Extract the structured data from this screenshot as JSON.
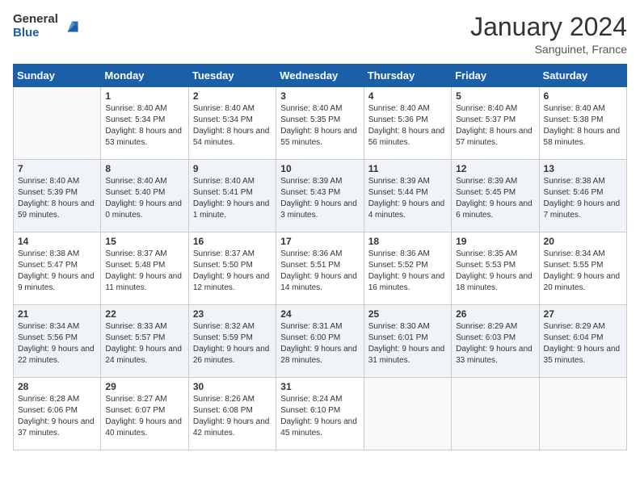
{
  "logo": {
    "general": "General",
    "blue": "Blue"
  },
  "header": {
    "month": "January 2024",
    "location": "Sanguinet, France"
  },
  "weekdays": [
    "Sunday",
    "Monday",
    "Tuesday",
    "Wednesday",
    "Thursday",
    "Friday",
    "Saturday"
  ],
  "weeks": [
    [
      {
        "day": "",
        "sunrise": "",
        "sunset": "",
        "daylight": ""
      },
      {
        "day": "1",
        "sunrise": "Sunrise: 8:40 AM",
        "sunset": "Sunset: 5:34 PM",
        "daylight": "Daylight: 8 hours and 53 minutes."
      },
      {
        "day": "2",
        "sunrise": "Sunrise: 8:40 AM",
        "sunset": "Sunset: 5:34 PM",
        "daylight": "Daylight: 8 hours and 54 minutes."
      },
      {
        "day": "3",
        "sunrise": "Sunrise: 8:40 AM",
        "sunset": "Sunset: 5:35 PM",
        "daylight": "Daylight: 8 hours and 55 minutes."
      },
      {
        "day": "4",
        "sunrise": "Sunrise: 8:40 AM",
        "sunset": "Sunset: 5:36 PM",
        "daylight": "Daylight: 8 hours and 56 minutes."
      },
      {
        "day": "5",
        "sunrise": "Sunrise: 8:40 AM",
        "sunset": "Sunset: 5:37 PM",
        "daylight": "Daylight: 8 hours and 57 minutes."
      },
      {
        "day": "6",
        "sunrise": "Sunrise: 8:40 AM",
        "sunset": "Sunset: 5:38 PM",
        "daylight": "Daylight: 8 hours and 58 minutes."
      }
    ],
    [
      {
        "day": "7",
        "sunrise": "Sunrise: 8:40 AM",
        "sunset": "Sunset: 5:39 PM",
        "daylight": "Daylight: 8 hours and 59 minutes."
      },
      {
        "day": "8",
        "sunrise": "Sunrise: 8:40 AM",
        "sunset": "Sunset: 5:40 PM",
        "daylight": "Daylight: 9 hours and 0 minutes."
      },
      {
        "day": "9",
        "sunrise": "Sunrise: 8:40 AM",
        "sunset": "Sunset: 5:41 PM",
        "daylight": "Daylight: 9 hours and 1 minute."
      },
      {
        "day": "10",
        "sunrise": "Sunrise: 8:39 AM",
        "sunset": "Sunset: 5:43 PM",
        "daylight": "Daylight: 9 hours and 3 minutes."
      },
      {
        "day": "11",
        "sunrise": "Sunrise: 8:39 AM",
        "sunset": "Sunset: 5:44 PM",
        "daylight": "Daylight: 9 hours and 4 minutes."
      },
      {
        "day": "12",
        "sunrise": "Sunrise: 8:39 AM",
        "sunset": "Sunset: 5:45 PM",
        "daylight": "Daylight: 9 hours and 6 minutes."
      },
      {
        "day": "13",
        "sunrise": "Sunrise: 8:38 AM",
        "sunset": "Sunset: 5:46 PM",
        "daylight": "Daylight: 9 hours and 7 minutes."
      }
    ],
    [
      {
        "day": "14",
        "sunrise": "Sunrise: 8:38 AM",
        "sunset": "Sunset: 5:47 PM",
        "daylight": "Daylight: 9 hours and 9 minutes."
      },
      {
        "day": "15",
        "sunrise": "Sunrise: 8:37 AM",
        "sunset": "Sunset: 5:48 PM",
        "daylight": "Daylight: 9 hours and 11 minutes."
      },
      {
        "day": "16",
        "sunrise": "Sunrise: 8:37 AM",
        "sunset": "Sunset: 5:50 PM",
        "daylight": "Daylight: 9 hours and 12 minutes."
      },
      {
        "day": "17",
        "sunrise": "Sunrise: 8:36 AM",
        "sunset": "Sunset: 5:51 PM",
        "daylight": "Daylight: 9 hours and 14 minutes."
      },
      {
        "day": "18",
        "sunrise": "Sunrise: 8:36 AM",
        "sunset": "Sunset: 5:52 PM",
        "daylight": "Daylight: 9 hours and 16 minutes."
      },
      {
        "day": "19",
        "sunrise": "Sunrise: 8:35 AM",
        "sunset": "Sunset: 5:53 PM",
        "daylight": "Daylight: 9 hours and 18 minutes."
      },
      {
        "day": "20",
        "sunrise": "Sunrise: 8:34 AM",
        "sunset": "Sunset: 5:55 PM",
        "daylight": "Daylight: 9 hours and 20 minutes."
      }
    ],
    [
      {
        "day": "21",
        "sunrise": "Sunrise: 8:34 AM",
        "sunset": "Sunset: 5:56 PM",
        "daylight": "Daylight: 9 hours and 22 minutes."
      },
      {
        "day": "22",
        "sunrise": "Sunrise: 8:33 AM",
        "sunset": "Sunset: 5:57 PM",
        "daylight": "Daylight: 9 hours and 24 minutes."
      },
      {
        "day": "23",
        "sunrise": "Sunrise: 8:32 AM",
        "sunset": "Sunset: 5:59 PM",
        "daylight": "Daylight: 9 hours and 26 minutes."
      },
      {
        "day": "24",
        "sunrise": "Sunrise: 8:31 AM",
        "sunset": "Sunset: 6:00 PM",
        "daylight": "Daylight: 9 hours and 28 minutes."
      },
      {
        "day": "25",
        "sunrise": "Sunrise: 8:30 AM",
        "sunset": "Sunset: 6:01 PM",
        "daylight": "Daylight: 9 hours and 31 minutes."
      },
      {
        "day": "26",
        "sunrise": "Sunrise: 8:29 AM",
        "sunset": "Sunset: 6:03 PM",
        "daylight": "Daylight: 9 hours and 33 minutes."
      },
      {
        "day": "27",
        "sunrise": "Sunrise: 8:29 AM",
        "sunset": "Sunset: 6:04 PM",
        "daylight": "Daylight: 9 hours and 35 minutes."
      }
    ],
    [
      {
        "day": "28",
        "sunrise": "Sunrise: 8:28 AM",
        "sunset": "Sunset: 6:06 PM",
        "daylight": "Daylight: 9 hours and 37 minutes."
      },
      {
        "day": "29",
        "sunrise": "Sunrise: 8:27 AM",
        "sunset": "Sunset: 6:07 PM",
        "daylight": "Daylight: 9 hours and 40 minutes."
      },
      {
        "day": "30",
        "sunrise": "Sunrise: 8:26 AM",
        "sunset": "Sunset: 6:08 PM",
        "daylight": "Daylight: 9 hours and 42 minutes."
      },
      {
        "day": "31",
        "sunrise": "Sunrise: 8:24 AM",
        "sunset": "Sunset: 6:10 PM",
        "daylight": "Daylight: 9 hours and 45 minutes."
      },
      {
        "day": "",
        "sunrise": "",
        "sunset": "",
        "daylight": ""
      },
      {
        "day": "",
        "sunrise": "",
        "sunset": "",
        "daylight": ""
      },
      {
        "day": "",
        "sunrise": "",
        "sunset": "",
        "daylight": ""
      }
    ]
  ]
}
